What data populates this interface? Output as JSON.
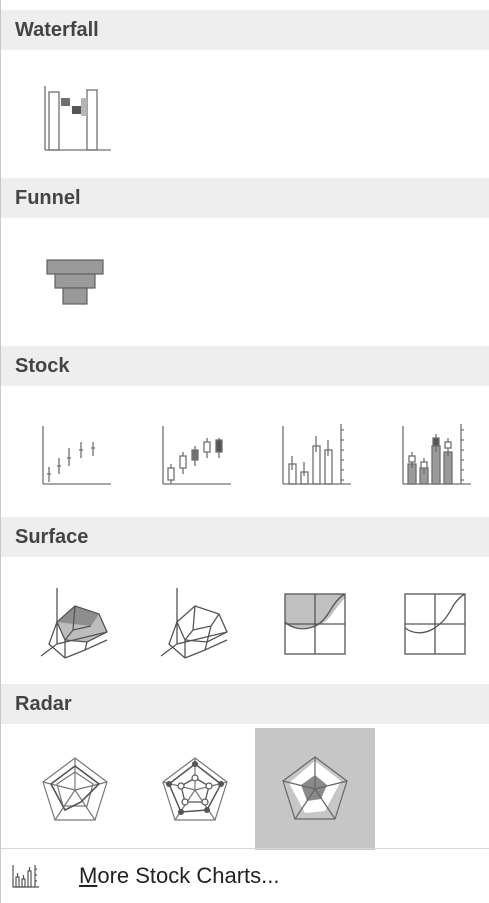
{
  "sections": [
    {
      "title": "Waterfall"
    },
    {
      "title": "Funnel"
    },
    {
      "title": "Stock"
    },
    {
      "title": "Surface"
    },
    {
      "title": "Radar"
    }
  ],
  "tiles": {
    "waterfall": [
      {
        "icon": "waterfall-chart-icon"
      }
    ],
    "funnel": [
      {
        "icon": "funnel-chart-icon"
      }
    ],
    "stock": [
      {
        "icon": "stock-high-low-close-icon"
      },
      {
        "icon": "stock-open-high-low-close-icon"
      },
      {
        "icon": "stock-volume-high-low-close-icon"
      },
      {
        "icon": "stock-volume-open-high-low-close-icon"
      }
    ],
    "surface": [
      {
        "icon": "3d-surface-icon"
      },
      {
        "icon": "wireframe-3d-surface-icon"
      },
      {
        "icon": "contour-icon"
      },
      {
        "icon": "wireframe-contour-icon"
      }
    ],
    "radar": [
      {
        "icon": "radar-icon"
      },
      {
        "icon": "radar-with-markers-icon"
      },
      {
        "icon": "filled-radar-icon",
        "selected": true
      }
    ]
  },
  "footer": {
    "mnemonic": "M",
    "label_rest": "ore Stock Charts..."
  },
  "colors": {
    "header_bg": "#eeeeee",
    "selected_bg": "#c6c6c6",
    "icon_stroke": "#707070",
    "icon_fill": "#9a9a9a"
  }
}
